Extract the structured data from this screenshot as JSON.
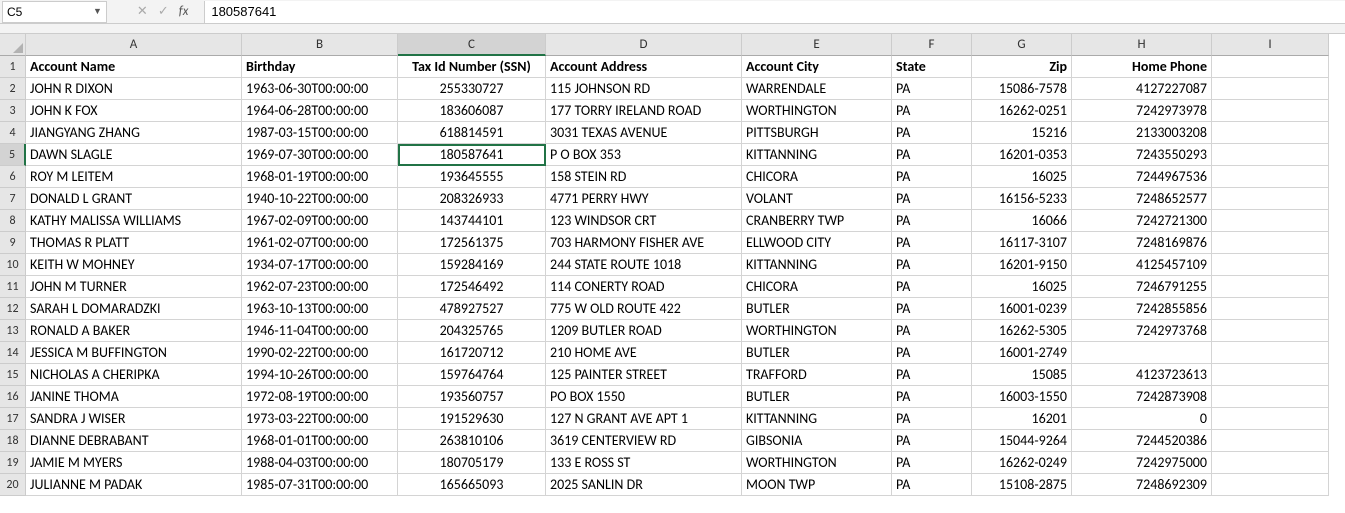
{
  "nameBox": {
    "value": "C5"
  },
  "formula": {
    "value": "180587641"
  },
  "selection": {
    "row": 5,
    "col": "C"
  },
  "columns": [
    "A",
    "B",
    "C",
    "D",
    "E",
    "F",
    "G",
    "H",
    "I"
  ],
  "headers": {
    "A": "Account Name",
    "B": "Birthday",
    "C": "Tax Id Number (SSN)",
    "D": "Account Address",
    "E": "Account City",
    "F": "State",
    "G": "Zip",
    "H": "Home Phone",
    "I": ""
  },
  "align": {
    "C": "center",
    "G": "right",
    "H": "right"
  },
  "rows": [
    {
      "A": "JOHN R DIXON",
      "B": "1963-06-30T00:00:00",
      "C": "255330727",
      "D": "115 JOHNSON RD",
      "E": "WARRENDALE",
      "F": "PA",
      "G": "15086-7578",
      "H": "4127227087"
    },
    {
      "A": "JOHN K FOX",
      "B": "1964-06-28T00:00:00",
      "C": "183606087",
      "D": "177 TORRY IRELAND ROAD",
      "E": "WORTHINGTON",
      "F": "PA",
      "G": "16262-0251",
      "H": "7242973978"
    },
    {
      "A": "JIANGYANG ZHANG",
      "B": "1987-03-15T00:00:00",
      "C": "618814591",
      "D": "3031 TEXAS AVENUE",
      "E": "PITTSBURGH",
      "F": "PA",
      "G": "15216",
      "H": "2133003208"
    },
    {
      "A": "DAWN SLAGLE",
      "B": "1969-07-30T00:00:00",
      "C": "180587641",
      "D": "P O BOX 353",
      "E": "KITTANNING",
      "F": "PA",
      "G": "16201-0353",
      "H": "7243550293"
    },
    {
      "A": "ROY M LEITEM",
      "B": "1968-01-19T00:00:00",
      "C": "193645555",
      "D": "158 STEIN RD",
      "E": "CHICORA",
      "F": "PA",
      "G": "16025",
      "H": "7244967536"
    },
    {
      "A": "DONALD L GRANT",
      "B": "1940-10-22T00:00:00",
      "C": "208326933",
      "D": "4771 PERRY HWY",
      "E": "VOLANT",
      "F": "PA",
      "G": "16156-5233",
      "H": "7248652577"
    },
    {
      "A": "KATHY MALISSA WILLIAMS",
      "B": "1967-02-09T00:00:00",
      "C": "143744101",
      "D": "123 WINDSOR CRT",
      "E": "CRANBERRY TWP",
      "F": "PA",
      "G": "16066",
      "H": "7242721300"
    },
    {
      "A": "THOMAS R PLATT",
      "B": "1961-02-07T00:00:00",
      "C": "172561375",
      "D": "703 HARMONY FISHER AVE",
      "E": "ELLWOOD CITY",
      "F": "PA",
      "G": "16117-3107",
      "H": "7248169876"
    },
    {
      "A": "KEITH W MOHNEY",
      "B": "1934-07-17T00:00:00",
      "C": "159284169",
      "D": "244 STATE ROUTE 1018",
      "E": "KITTANNING",
      "F": "PA",
      "G": "16201-9150",
      "H": "4125457109"
    },
    {
      "A": "JOHN M TURNER",
      "B": "1962-07-23T00:00:00",
      "C": "172546492",
      "D": "114 CONERTY ROAD",
      "E": "CHICORA",
      "F": "PA",
      "G": "16025",
      "H": "7246791255"
    },
    {
      "A": "SARAH L DOMARADZKI",
      "B": "1963-10-13T00:00:00",
      "C": "478927527",
      "D": "775 W OLD ROUTE 422",
      "E": "BUTLER",
      "F": "PA",
      "G": "16001-0239",
      "H": "7242855856"
    },
    {
      "A": "RONALD A BAKER",
      "B": "1946-11-04T00:00:00",
      "C": "204325765",
      "D": "1209 BUTLER ROAD",
      "E": "WORTHINGTON",
      "F": "PA",
      "G": "16262-5305",
      "H": "7242973768"
    },
    {
      "A": "JESSICA M BUFFINGTON",
      "B": "1990-02-22T00:00:00",
      "C": "161720712",
      "D": "210 HOME AVE",
      "E": "BUTLER",
      "F": "PA",
      "G": "16001-2749",
      "H": ""
    },
    {
      "A": "NICHOLAS A CHERIPKA",
      "B": "1994-10-26T00:00:00",
      "C": "159764764",
      "D": "125 PAINTER STREET",
      "E": "TRAFFORD",
      "F": "PA",
      "G": "15085",
      "H": "4123723613"
    },
    {
      "A": "JANINE THOMA",
      "B": "1972-08-19T00:00:00",
      "C": "193560757",
      "D": "PO BOX 1550",
      "E": "BUTLER",
      "F": "PA",
      "G": "16003-1550",
      "H": "7242873908"
    },
    {
      "A": "SANDRA J WISER",
      "B": "1973-03-22T00:00:00",
      "C": "191529630",
      "D": "127 N GRANT AVE APT 1",
      "E": "KITTANNING",
      "F": "PA",
      "G": "16201",
      "H": "0"
    },
    {
      "A": "DIANNE DEBRABANT",
      "B": "1968-01-01T00:00:00",
      "C": "263810106",
      "D": "3619 CENTERVIEW RD",
      "E": "GIBSONIA",
      "F": "PA",
      "G": "15044-9264",
      "H": "7244520386"
    },
    {
      "A": "JAMIE M MYERS",
      "B": "1988-04-03T00:00:00",
      "C": "180705179",
      "D": "133 E ROSS ST",
      "E": "WORTHINGTON",
      "F": "PA",
      "G": "16262-0249",
      "H": "7242975000"
    },
    {
      "A": "JULIANNE M PADAK",
      "B": "1985-07-31T00:00:00",
      "C": "165665093",
      "D": "2025 SANLIN DR",
      "E": "MOON TWP",
      "F": "PA",
      "G": "15108-2875",
      "H": "7248692309"
    }
  ]
}
